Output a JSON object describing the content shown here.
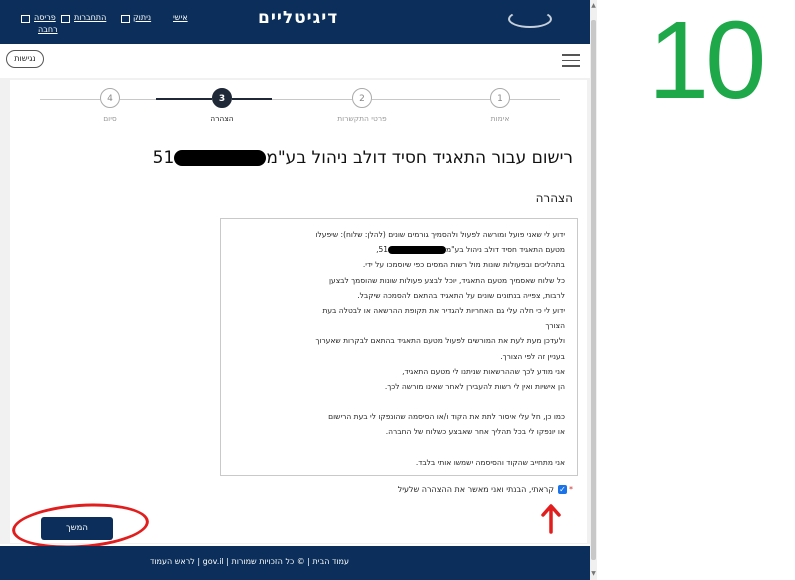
{
  "header": {
    "site_title": "דיגיטליים",
    "link_personal": "אישי",
    "link_logout": "ניתוק",
    "link_connect": "התחברות",
    "link_expand_1": "פריסה",
    "link_expand_2": "רחבה"
  },
  "navbar": {
    "accessibility_label": "נגישות"
  },
  "stepper": {
    "steps": [
      {
        "number": "1",
        "label": "אימות"
      },
      {
        "number": "2",
        "label": "פרטי התקשרות"
      },
      {
        "number": "3",
        "label": "הצהרה"
      },
      {
        "number": "4",
        "label": "סיום"
      }
    ],
    "active_step": 3
  },
  "page": {
    "title_main": "רישום עבור התאגיד חסיד דולב ניהול בע\"מ",
    "title_suffix": "51",
    "section_title": "הצהרה"
  },
  "declaration": {
    "line1": "ידוע לי שאני פועל ומורשה לפעול ולהסמיך גורמים שונים (להלן: שלוח): שיפעלו",
    "line2a": "מטעם התאגיד חסיד דולב ניהול בע\"מ",
    "line2b": "51",
    "line2c": ",",
    "line3": "בתהליכים ובפעולות שונות מול רשות המסים כפי שיוסמכו על ידי.",
    "line4": "כל שלוח שאסמיך מטעם התאגיד, יוכל לבצע פעולות שונות שהוסמך לבצען",
    "line5": "לרבות, צפייה בנתונים שונים על התאגיד בהתאם להסמכה שיקבל.",
    "line6": "ידוע לי כי חלה עלי גם האחריות להגדיר את תקופת ההרשאה או לבטלה בעת",
    "line7": "הצורך",
    "line8": "ולעדכן מעת לעת את המורשים לפעול מטעם התאגיד בהתאם לבקרות שאערוך",
    "line9": "בעניין זה לפי הצורך.",
    "line10": "אני מודע לכך שההרשאות שניתנו לי מטעם התאגיד,",
    "line11": "הן אישיות ואין לי רשות להעבירן לאחר שאינו מורשה לכך.",
    "line12": "כמו כן, חל עלי איסור לתת את הקוד ו/או הסיסמה שהונפקו לי בעת הרישום",
    "line13": "או יונפקו לי בכל תהליך אחר שאבצע כשלוח של החברה.",
    "line14": "אני מתחייב שהקוד והסיסמה ישמשו אותי בלבד."
  },
  "consent": {
    "label": "קראתי, הבנתי ואני מאשר את ההצהרה שלעיל",
    "checked": true,
    "required_mark": "*",
    "check_glyph": "✓"
  },
  "continue_button": "המשך",
  "footer": {
    "text": "עמוד הבית | © כל הזכויות שמורות | gov.il | לראש העמוד"
  },
  "overlay_number": "10",
  "colors": {
    "brand_navy": "#0b2f5a",
    "annotation_red": "#e11d1d",
    "number_green": "#1fa84a",
    "checkbox_blue": "#1a73e8"
  },
  "scrollbar": {
    "up_glyph": "▲",
    "down_glyph": "▼"
  }
}
